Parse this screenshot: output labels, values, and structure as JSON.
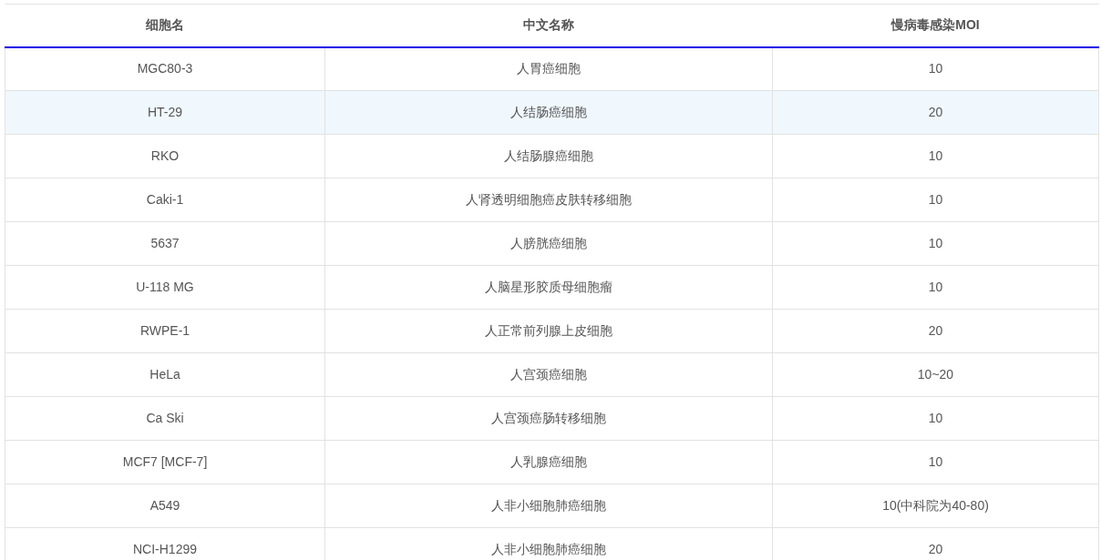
{
  "table": {
    "columns": [
      "细胞名",
      "中文名称",
      "慢病毒感染MOI"
    ],
    "rows": [
      {
        "cells": [
          "MGC80-3",
          "人胃癌细胞",
          "10"
        ],
        "highlighted": false
      },
      {
        "cells": [
          "HT-29",
          "人结肠癌细胞",
          "20"
        ],
        "highlighted": true
      },
      {
        "cells": [
          "RKO",
          "人结肠腺癌细胞",
          "10"
        ],
        "highlighted": false
      },
      {
        "cells": [
          "Caki-1",
          "人肾透明细胞癌皮肤转移细胞",
          "10"
        ],
        "highlighted": false
      },
      {
        "cells": [
          "5637",
          "人膀胱癌细胞",
          "10"
        ],
        "highlighted": false
      },
      {
        "cells": [
          "U-118 MG",
          "人脑星形胶质母细胞瘤",
          "10"
        ],
        "highlighted": false
      },
      {
        "cells": [
          "RWPE-1",
          "人正常前列腺上皮细胞",
          "20"
        ],
        "highlighted": false
      },
      {
        "cells": [
          "HeLa",
          "人宫颈癌细胞",
          "10~20"
        ],
        "highlighted": false
      },
      {
        "cells": [
          "Ca Ski",
          "人宫颈癌肠转移细胞",
          "10"
        ],
        "highlighted": false
      },
      {
        "cells": [
          "MCF7 [MCF-7]",
          "人乳腺癌细胞",
          "10"
        ],
        "highlighted": false
      },
      {
        "cells": [
          "A549",
          "人非小细胞肺癌细胞",
          "10(中科院为40-80)"
        ],
        "highlighted": false
      },
      {
        "cells": [
          "NCI-H1299",
          "人非小细胞肺癌细胞",
          "20"
        ],
        "highlighted": false
      }
    ]
  }
}
